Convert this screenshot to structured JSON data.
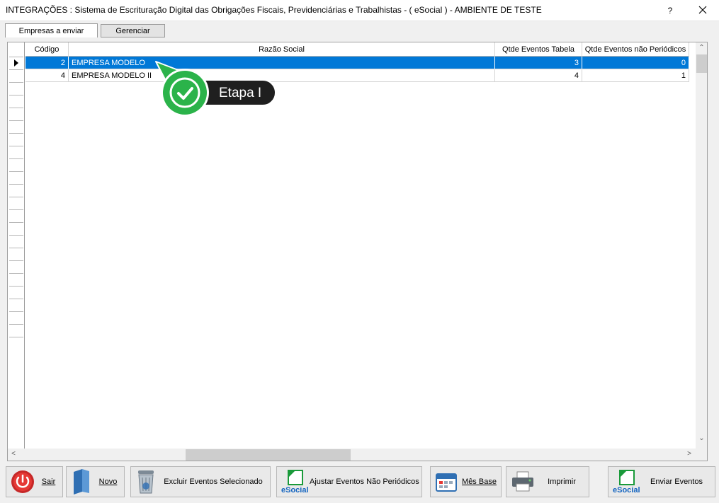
{
  "window": {
    "title": "INTEGRAÇÕES : Sistema de Escrituração Digital das Obrigações Fiscais, Previdenciárias e Trabalhistas - ( eSocial ) - AMBIENTE DE TESTE",
    "help": "?"
  },
  "tabs": [
    {
      "label": "Empresas a enviar",
      "active": true
    },
    {
      "label": "Gerenciar",
      "active": false
    }
  ],
  "grid": {
    "columns": [
      "Código",
      "Razão Social",
      "Qtde Eventos Tabela",
      "Qtde Eventos não Periódicos"
    ],
    "rows": [
      {
        "codigo": "2",
        "razao": "EMPRESA MODELO",
        "tabela": "3",
        "nao_periodicos": "0",
        "selected": true
      },
      {
        "codigo": "4",
        "razao": "EMPRESA MODELO II",
        "tabela": "4",
        "nao_periodicos": "1",
        "selected": false
      }
    ],
    "scroll": {
      "up": "⌃",
      "down": "⌄",
      "left": "<",
      "right": ">"
    }
  },
  "annotation": {
    "label": "Etapa I",
    "accent": "#2bb34a"
  },
  "buttons": {
    "sair": "Sair",
    "novo": "Novo",
    "excluir": "Excluir Eventos Selecionado",
    "ajustar": "Ajustar Eventos Não Periódicos",
    "mes_base": "Mês Base",
    "imprimir": "Imprimir",
    "enviar": "Enviar Eventos",
    "esocial_logo": "eSocial"
  },
  "colors": {
    "selection": "#0078d7",
    "esocial_green": "#1a9a3a",
    "esocial_blue": "#1565c0"
  }
}
